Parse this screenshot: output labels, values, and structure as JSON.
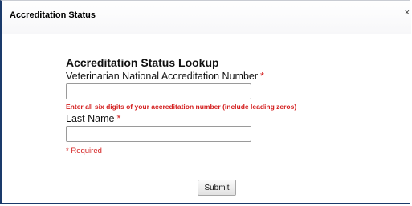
{
  "dialog": {
    "title": "Accreditation Status",
    "close_glyph": "×"
  },
  "form": {
    "heading": "Accreditation Status Lookup",
    "accreditation_label": "Veterinarian National Accreditation Number",
    "accreditation_value": "",
    "accreditation_placeholder": "",
    "hint": "Enter all six digits of your accreditation number (include leading zeros)",
    "last_name_label": "Last Name",
    "last_name_value": "",
    "last_name_placeholder": "",
    "required_star": "*",
    "required_note": "Required",
    "submit_label": "Submit"
  },
  "colors": {
    "required": "#d42020",
    "frame_accent": "#1a3a6b"
  }
}
